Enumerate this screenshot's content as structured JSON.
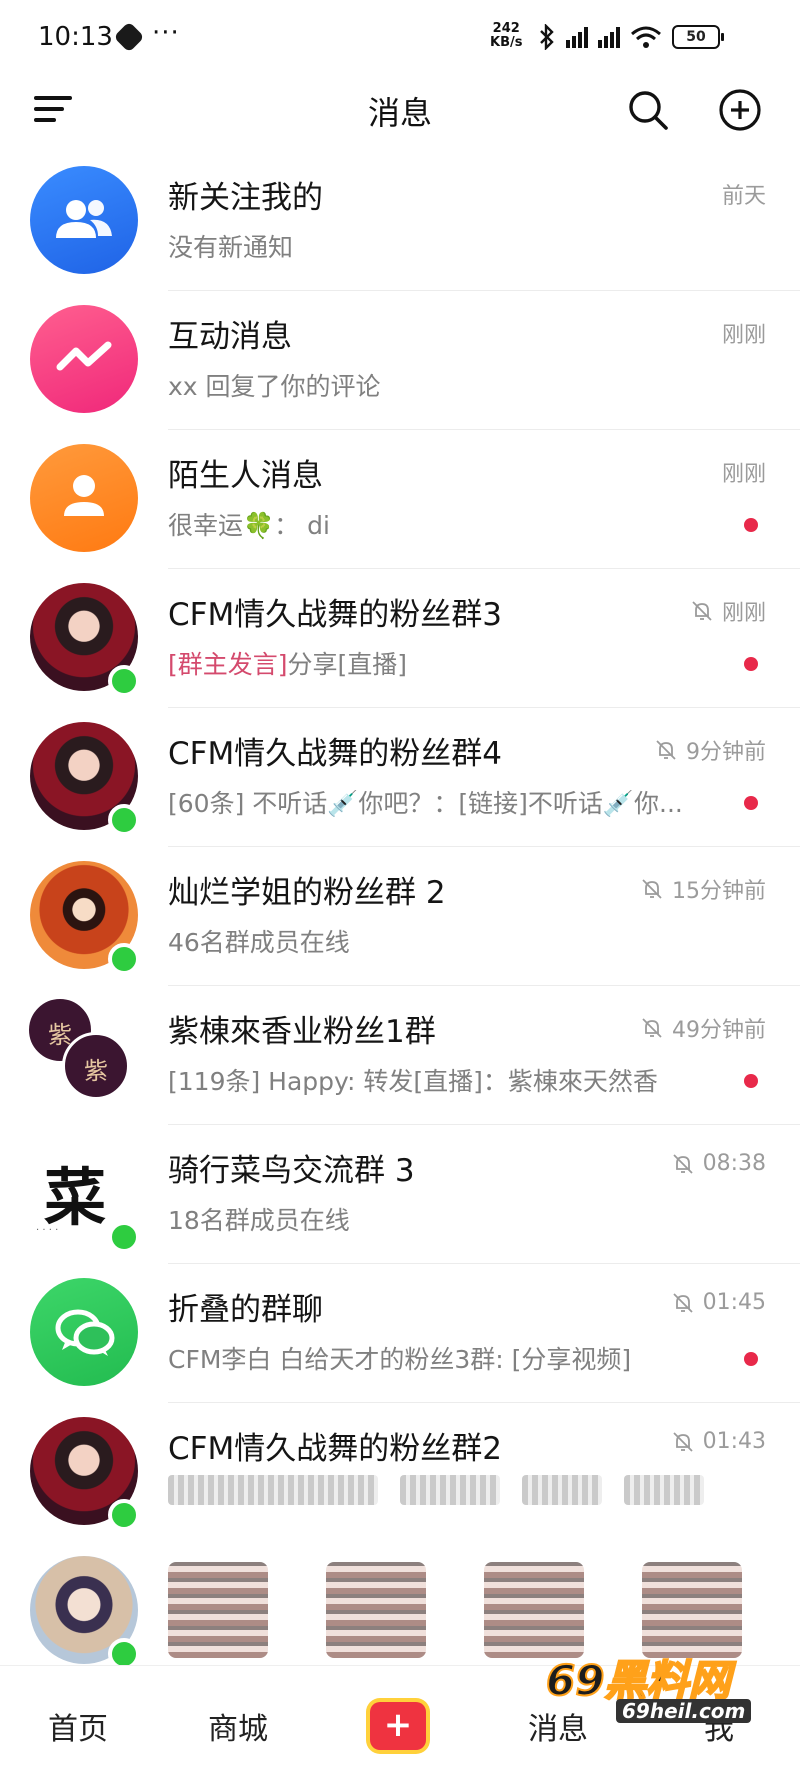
{
  "status_bar": {
    "time": "10:13",
    "dots": "···",
    "net_speed_value": "242",
    "net_speed_unit": "KB/s",
    "battery": "50"
  },
  "header": {
    "title": "消息"
  },
  "conversations": [
    {
      "title": "新关注我的",
      "subtitle": "没有新通知",
      "time": "前天",
      "muted": false,
      "unread": false,
      "avatar": "people-icon"
    },
    {
      "title": "互动消息",
      "subtitle": "xx 回复了你的评论",
      "time": "刚刚",
      "muted": false,
      "unread": false,
      "avatar": "zigzag-icon"
    },
    {
      "title": "陌生人消息",
      "subtitle": "很幸运🍀：  di",
      "time": "刚刚",
      "muted": false,
      "unread": true,
      "avatar": "person-icon"
    },
    {
      "title": "CFM情久战舞的粉丝群3",
      "subtitle_highlight": "[群主发言]",
      "subtitle": "分享[直播]",
      "time": "刚刚",
      "muted": true,
      "unread": true,
      "avatar": "group-photo"
    },
    {
      "title": "CFM情久战舞的粉丝群4",
      "subtitle": "[60条] 不听话💉你吧？：[链接]不听话💉你...",
      "time": "9分钟前",
      "muted": true,
      "unread": true,
      "avatar": "group-photo"
    },
    {
      "title": "灿烂学姐的粉丝群 2",
      "subtitle": "46名群成员在线",
      "time": "15分钟前",
      "muted": true,
      "unread": false,
      "avatar": "group-photo"
    },
    {
      "title": "紫棟來香业粉丝1群",
      "subtitle": "[119条] Happy: 转发[直播]：紫棟來天然香",
      "time": "49分钟前",
      "muted": true,
      "unread": true,
      "avatar": "double-circle-logo"
    },
    {
      "title": "骑行菜鸟交流群 3",
      "subtitle": "18名群成员在线",
      "time": "08:38",
      "muted": true,
      "unread": false,
      "avatar": "cai-logo"
    },
    {
      "title": "折叠的群聊",
      "subtitle": "CFM李白 白给天才的粉丝3群: [分享视频]",
      "time": "01:45",
      "muted": true,
      "unread": true,
      "avatar": "chat-bubbles-icon"
    },
    {
      "title": "CFM情久战舞的粉丝群2",
      "subtitle": "",
      "time": "01:43",
      "muted": true,
      "unread": false,
      "avatar": "group-photo"
    }
  ],
  "logos": {
    "zi": "紫",
    "cai": "菜"
  },
  "bottom_nav": {
    "home": "首页",
    "mall": "商城",
    "add": "+",
    "messages": "消息",
    "me": "我"
  },
  "watermark": {
    "text": "69黑料网",
    "url": "69heil.com"
  },
  "colors": {
    "unread_dot": "#e8294a",
    "online": "#2ecc40",
    "highlight": "#d44a6d",
    "add_button": "#ef3340"
  }
}
